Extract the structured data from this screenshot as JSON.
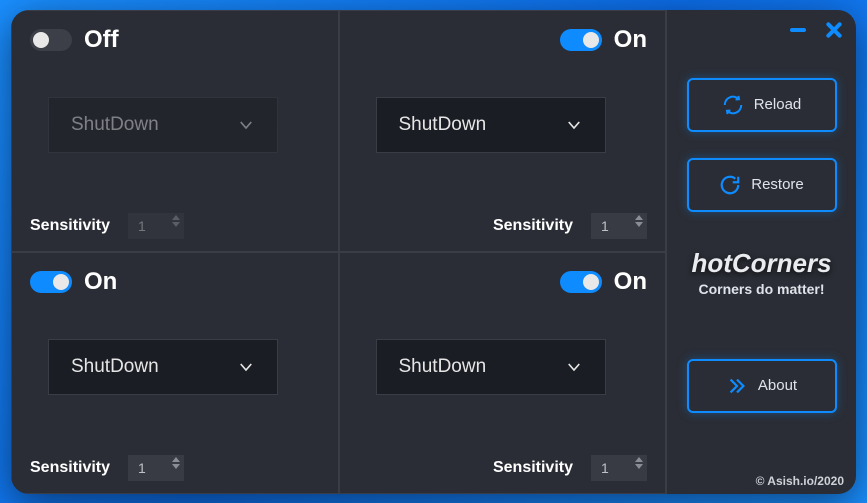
{
  "corners": {
    "top_left": {
      "enabled": false,
      "state_label": "Off",
      "action": "ShutDown",
      "sensitivity_label": "Sensitivity",
      "sensitivity": "1"
    },
    "top_right": {
      "enabled": true,
      "state_label": "On",
      "action": "ShutDown",
      "sensitivity_label": "Sensitivity",
      "sensitivity": "1"
    },
    "bottom_left": {
      "enabled": true,
      "state_label": "On",
      "action": "ShutDown",
      "sensitivity_label": "Sensitivity",
      "sensitivity": "1"
    },
    "bottom_right": {
      "enabled": true,
      "state_label": "On",
      "action": "ShutDown",
      "sensitivity_label": "Sensitivity",
      "sensitivity": "1"
    }
  },
  "sidebar": {
    "reload_label": "Reload",
    "restore_label": "Restore",
    "about_label": "About"
  },
  "brand": {
    "title": "hotCorners",
    "tagline": "Corners do matter!"
  },
  "footer": {
    "copyright": "© Asish.io/2020"
  }
}
